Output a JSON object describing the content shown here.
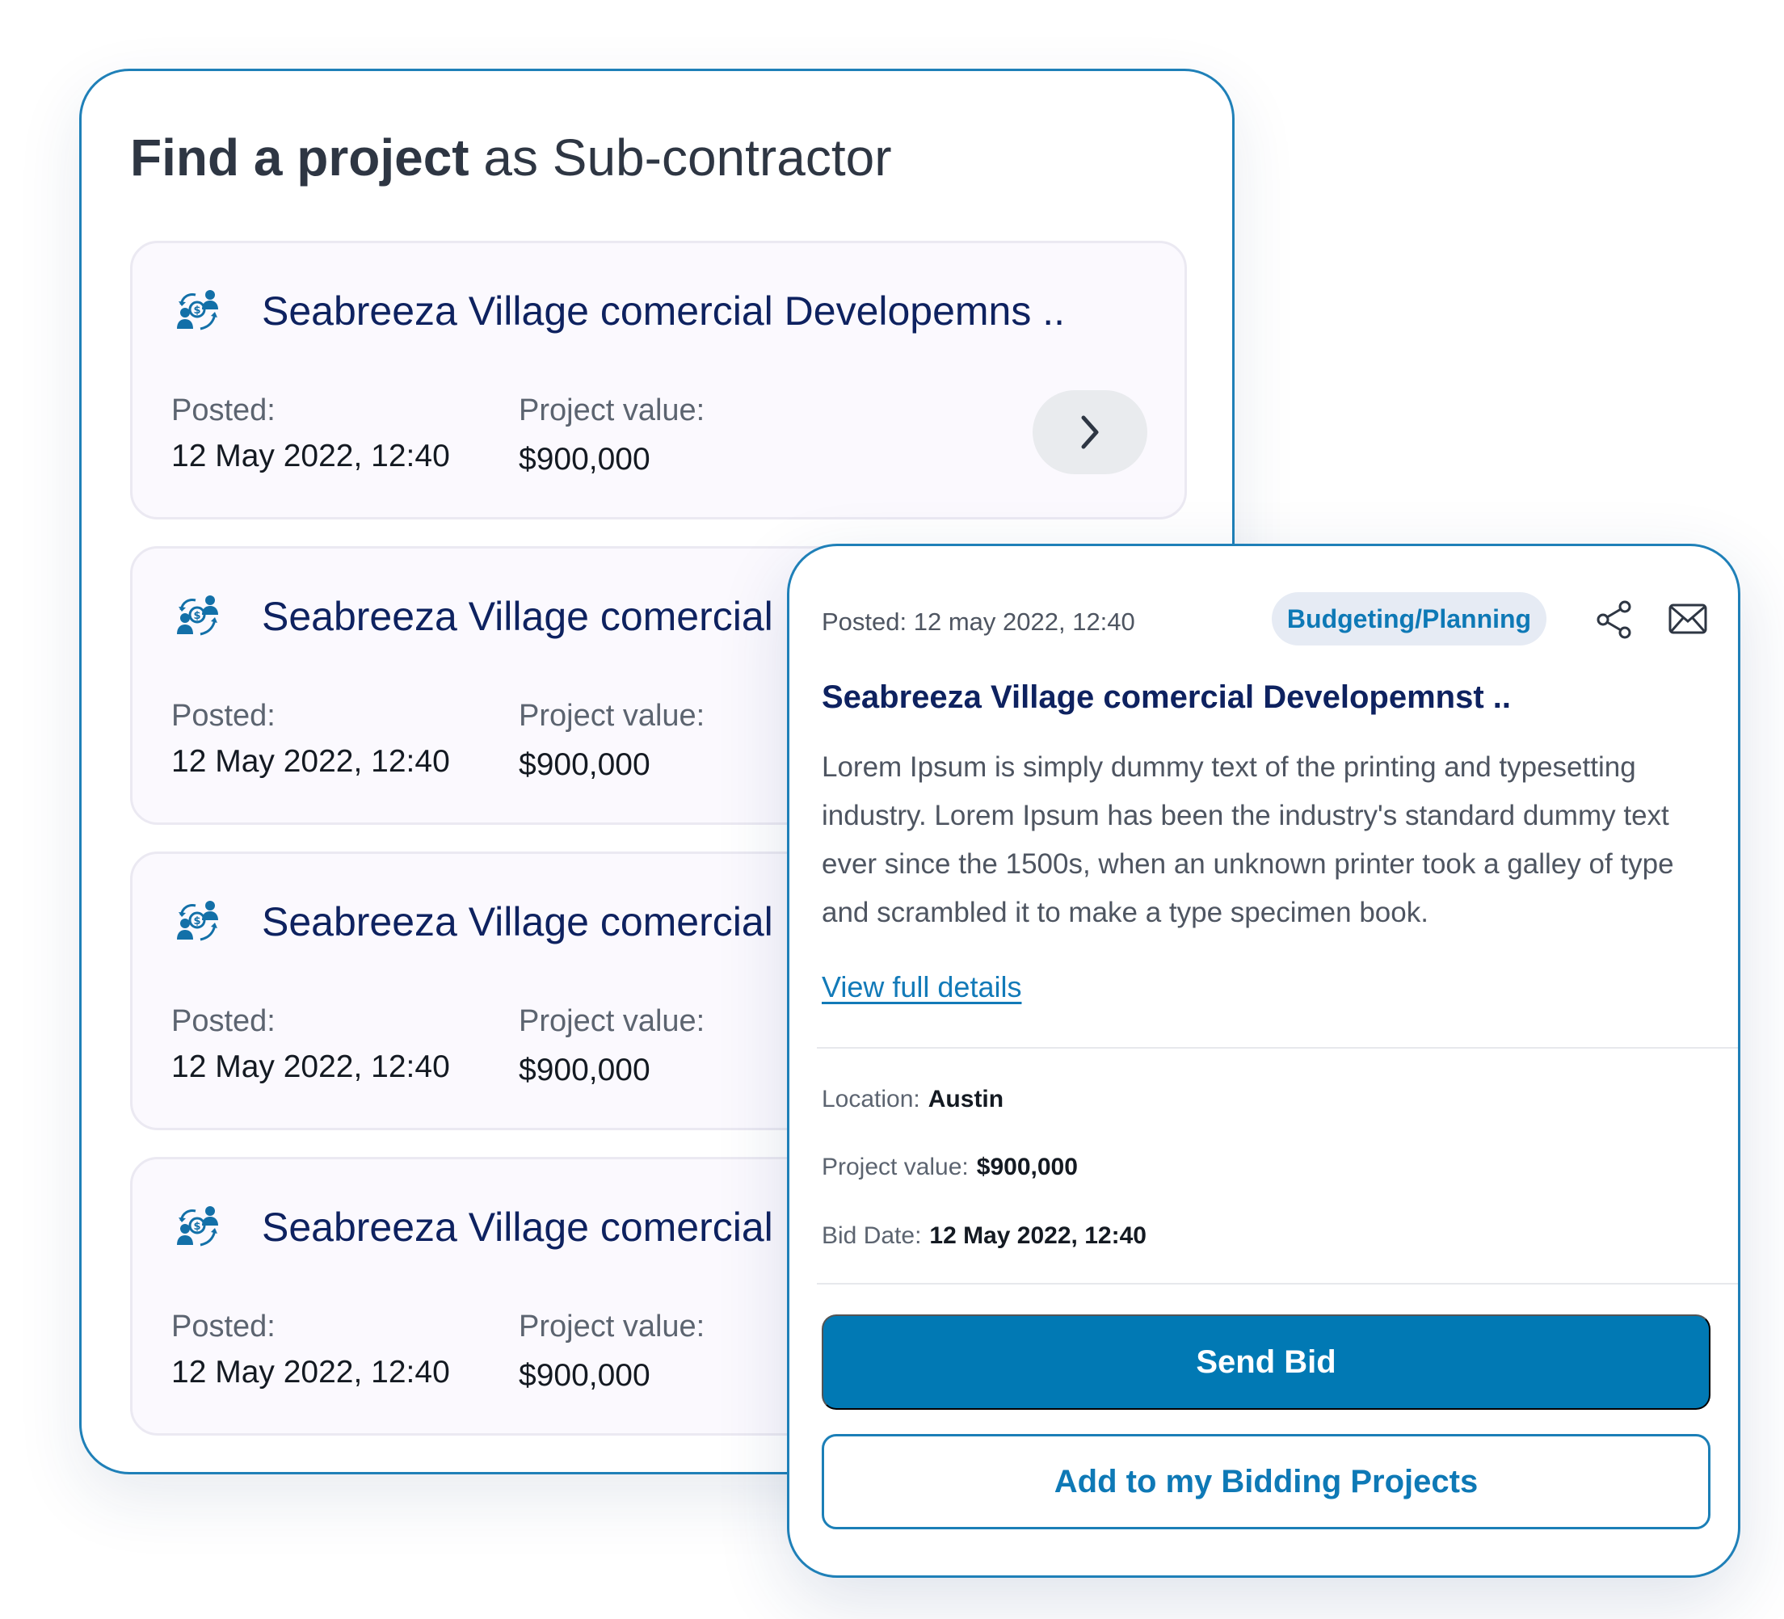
{
  "finder": {
    "title_bold": "Find a project",
    "title_rest": " as Sub-contractor",
    "cards": [
      {
        "title": "Seabreeza Village comercial Developemns ..",
        "posted_label": "Posted:",
        "posted": "12 May 2022, 12:40",
        "value_label": "Project value:",
        "value": "$900,000"
      },
      {
        "title": "Seabreeza Village comercial Developemns ..",
        "posted_label": "Posted:",
        "posted": "12 May 2022, 12:40",
        "value_label": "Project value:",
        "value": "$900,000"
      },
      {
        "title": "Seabreeza Village comercial Developemns ..",
        "posted_label": "Posted:",
        "posted": "12 May 2022, 12:40",
        "value_label": "Project value:",
        "value": "$900,000"
      },
      {
        "title": "Seabreeza Village comercial Developemns ..",
        "posted_label": "Posted:",
        "posted": "12 May 2022, 12:40",
        "value_label": "Project value:",
        "value": "$900,000"
      }
    ],
    "card_icon": "contractor-money-icon",
    "open_icon": "chevron-right-icon"
  },
  "detail": {
    "posted": "Posted: 12 may 2022, 12:40",
    "badge": "Budgeting/Planning",
    "share_icon": "share-icon",
    "mail_icon": "mail-icon",
    "title": "Seabreeza Village comercial Developemnst ..",
    "description": "Lorem Ipsum is simply dummy text of the printing and typesetting industry. Lorem Ipsum has been the industry's standard dummy text ever since the 1500s, when an unknown printer took a galley of type and scrambled it to make a type specimen book.",
    "link": "View full details",
    "location_label": "Location:",
    "location": "Austin",
    "value_label": "Project value:",
    "value": "$900,000",
    "bid_label": "Bid Date:",
    "bid_date": "12 May 2022, 12:40",
    "primary_button": "Send Bid",
    "secondary_button": "Add to my Bidding Projects"
  },
  "colors": {
    "accent": "#0179b4",
    "title_navy": "#0e2260",
    "panel_border": "#1f80b8",
    "badge_bg": "#e6ebf4"
  }
}
